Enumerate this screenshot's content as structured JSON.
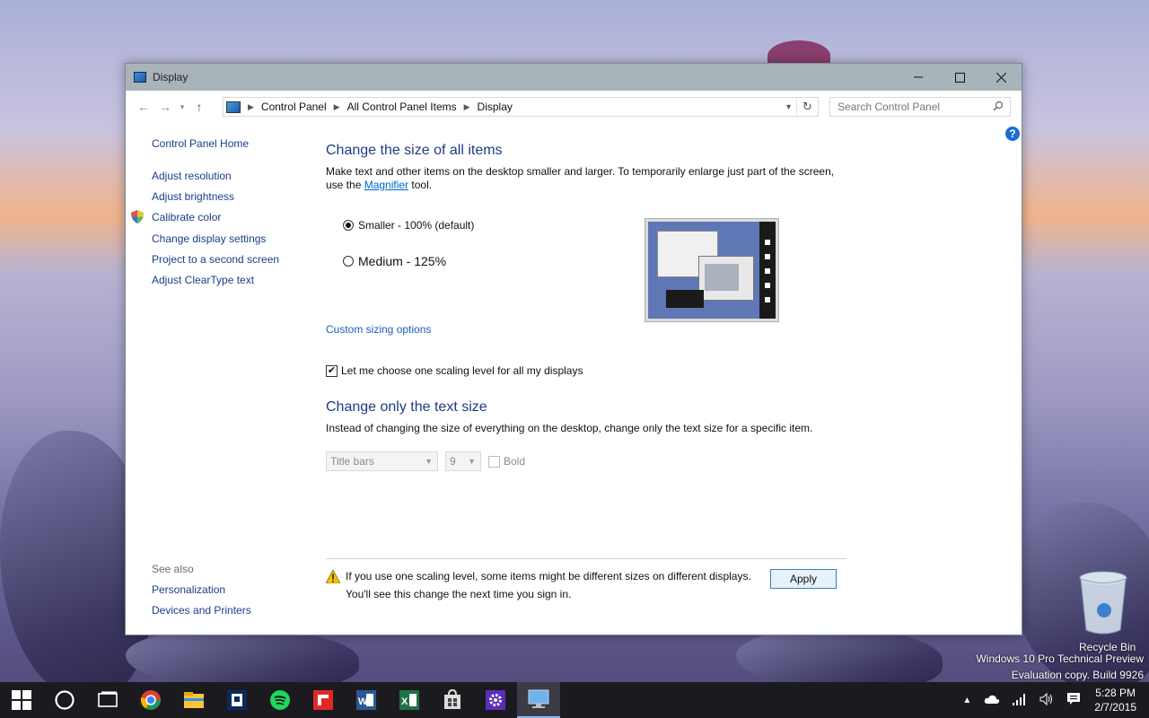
{
  "window": {
    "title": "Display"
  },
  "address": {
    "crumbs": [
      "Control Panel",
      "All Control Panel Items",
      "Display"
    ],
    "search_placeholder": "Search Control Panel"
  },
  "left_pane": {
    "home": "Control Panel Home",
    "links": [
      "Adjust resolution",
      "Adjust brightness",
      "Calibrate color",
      "Change display settings",
      "Project to a second screen",
      "Adjust ClearType text"
    ],
    "see_also_label": "See also",
    "see_also": [
      "Personalization",
      "Devices and Printers"
    ]
  },
  "main": {
    "heading_size": "Change the size of all items",
    "desc_size_1": "Make text and other items on the desktop smaller and larger. To temporarily enlarge just part of the screen,",
    "desc_size_2_pre": "use the ",
    "desc_size_2_link": "Magnifier",
    "desc_size_2_post": " tool.",
    "option_smaller": "Smaller - 100% (default)",
    "option_medium": "Medium - 125%",
    "selected_option": "Smaller - 100% (default)",
    "custom_sizing": "Custom sizing options",
    "scaling_checkbox": "Let me choose one scaling level for all my displays",
    "scaling_checked": true,
    "heading_text": "Change only the text size",
    "desc_text": "Instead of changing the size of everything on the desktop, change only the text size for a specific item.",
    "item_select": "Title bars",
    "size_select": "9",
    "bold_label": "Bold",
    "warning_1": "If you use one scaling level, some items might be different sizes on different displays.",
    "warning_2": "You'll see this change the next time you sign in.",
    "apply": "Apply"
  },
  "desktop": {
    "recycle_bin": "Recycle Bin",
    "watermark_1": "Windows 10 Pro Technical Preview",
    "watermark_2": "Evaluation copy. Build 9926"
  },
  "taskbar": {
    "time": "5:28 PM",
    "date": "2/7/2015",
    "apps": [
      "start-icon",
      "cortana-icon",
      "task-view-icon",
      "chrome-icon",
      "file-explorer-icon",
      "solitaire-icon",
      "spotify-icon",
      "flipboard-icon",
      "word-icon",
      "excel-icon",
      "store-icon",
      "settings-icon",
      "display-icon"
    ]
  }
}
